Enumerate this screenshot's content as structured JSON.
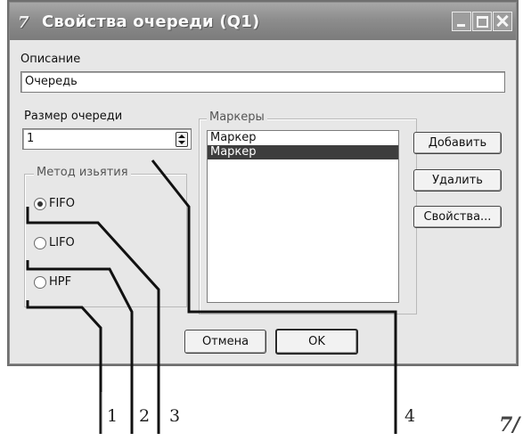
{
  "window": {
    "title": "Свойства очереди (Q1)"
  },
  "description": {
    "label": "Описание",
    "value": "Очередь"
  },
  "queue_size": {
    "label": "Размер очереди",
    "value": "1"
  },
  "extraction_method": {
    "caption": "Метод изьятия",
    "options": [
      {
        "label": "FIFO",
        "checked": true
      },
      {
        "label": "LIFO",
        "checked": false
      },
      {
        "label": "HPF",
        "checked": false
      }
    ]
  },
  "markers": {
    "caption": "Маркеры",
    "items": [
      {
        "label": "Маркер",
        "selected": false
      },
      {
        "label": "Маркер",
        "selected": true
      }
    ]
  },
  "buttons": {
    "add": "Добавить",
    "delete": "Удалить",
    "properties": "Свойства...",
    "cancel": "Отмена",
    "ok": "OK"
  },
  "callouts": [
    "1",
    "2",
    "3",
    "4"
  ],
  "icons": {
    "app": "app-logo-icon",
    "minimize": "minimize-icon",
    "maximize": "maximize-icon",
    "close": "close-icon"
  }
}
